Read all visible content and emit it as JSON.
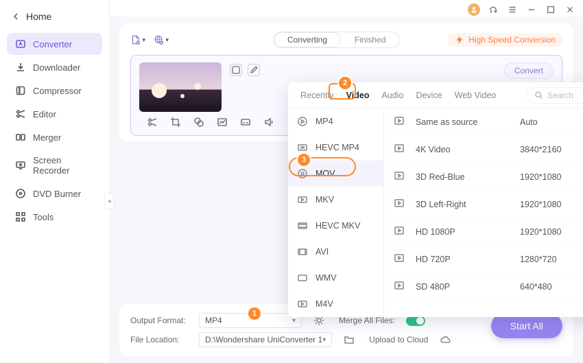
{
  "sidebar": {
    "back_label": "Home",
    "items": [
      {
        "label": "Converter"
      },
      {
        "label": "Downloader"
      },
      {
        "label": "Compressor"
      },
      {
        "label": "Editor"
      },
      {
        "label": "Merger"
      },
      {
        "label": "Screen Recorder"
      },
      {
        "label": "DVD Burner"
      },
      {
        "label": "Tools"
      }
    ]
  },
  "topbar": {
    "converting_label": "Converting",
    "finished_label": "Finished",
    "high_speed_label": "High Speed Conversion"
  },
  "filecard": {
    "convert_label": "Convert"
  },
  "popup": {
    "tabs": {
      "recently": "Recently",
      "video": "Video",
      "audio": "Audio",
      "device": "Device",
      "web_video": "Web Video"
    },
    "search_placeholder": "Search",
    "formats": [
      {
        "label": "MP4"
      },
      {
        "label": "HEVC MP4"
      },
      {
        "label": "MOV"
      },
      {
        "label": "MKV"
      },
      {
        "label": "HEVC MKV"
      },
      {
        "label": "AVI"
      },
      {
        "label": "WMV"
      },
      {
        "label": "M4V"
      }
    ],
    "resolutions": [
      {
        "label": "Same as source",
        "res": "Auto"
      },
      {
        "label": "4K Video",
        "res": "3840*2160"
      },
      {
        "label": "3D Red-Blue",
        "res": "1920*1080"
      },
      {
        "label": "3D Left-Right",
        "res": "1920*1080"
      },
      {
        "label": "HD 1080P",
        "res": "1920*1080"
      },
      {
        "label": "HD 720P",
        "res": "1280*720"
      },
      {
        "label": "SD 480P",
        "res": "640*480"
      }
    ]
  },
  "bottom": {
    "output_format_label": "Output Format:",
    "output_format_value": "MP4",
    "merge_all_label": "Merge All Files:",
    "file_location_label": "File Location:",
    "file_location_value": "D:\\Wondershare UniConverter 1",
    "upload_cloud_label": "Upload to Cloud",
    "start_all_label": "Start All"
  },
  "steps": {
    "s1": "1",
    "s2": "2",
    "s3": "3"
  }
}
